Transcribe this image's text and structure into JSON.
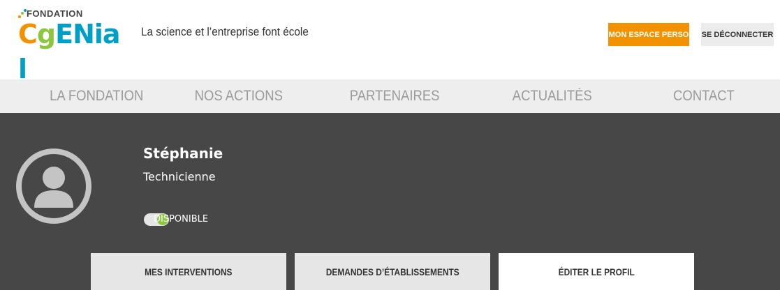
{
  "header": {
    "logo": {
      "small": "FONDATION",
      "main_letters": [
        {
          "char": "C",
          "color": "#f39200"
        },
        {
          "char": "g",
          "color": "#8cc63f"
        },
        {
          "char": "E",
          "color": "#00a0c6"
        },
        {
          "char": "N",
          "color": "#00a0c6"
        },
        {
          "char": "i",
          "color": "#00a0c6"
        },
        {
          "char": "a",
          "color": "#00a0c6"
        },
        {
          "char": "l",
          "color": "#00a0c6"
        }
      ],
      "dot_colors": [
        "#f39200",
        "#8cc63f",
        "#00a0c6"
      ]
    },
    "tagline": "La science et l’entreprise font école",
    "btn_perso": "MON ESPACE PERSO",
    "btn_logout": "SE DÉCONNECTER"
  },
  "nav": {
    "items": [
      "LA FONDATION",
      "NOS ACTIONS",
      "PARTENAIRES",
      "ACTUALITÉS",
      "CONTACT"
    ]
  },
  "profile": {
    "name": "Stéphanie",
    "role": "Technicienne",
    "availability_label": "DISPONIBLE",
    "available": true
  },
  "tabs": {
    "interventions": "MES INTERVENTIONS",
    "demandes": "DEMANDES D’ÉTABLISSEMENTS",
    "editer": "ÉDITER LE PROFIL",
    "active": "editer"
  },
  "colors": {
    "accent_orange": "#f39200",
    "accent_green": "#8cc63f",
    "profile_bg": "#474747",
    "nav_bg": "#eeeeee"
  }
}
